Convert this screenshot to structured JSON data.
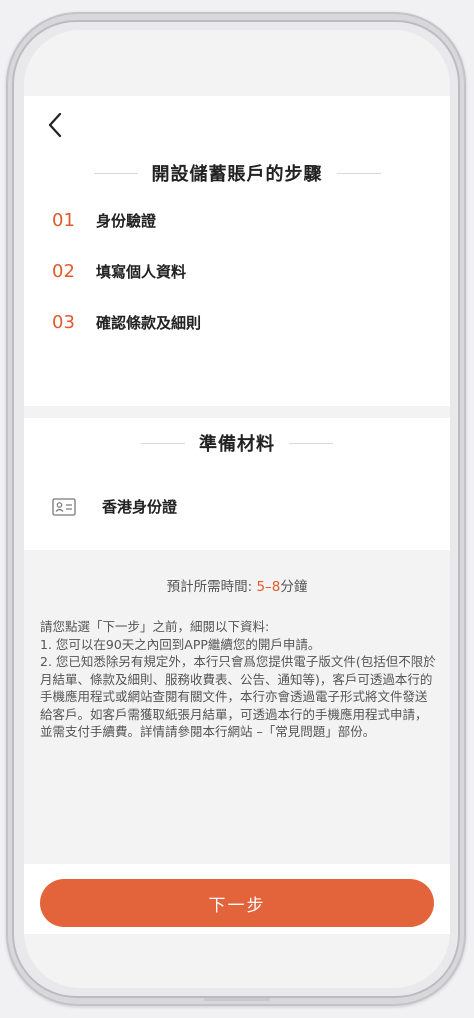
{
  "header": {
    "back_icon": "chevron-left-icon"
  },
  "steps": {
    "title": "開設儲蓄賬戶的步驟",
    "items": [
      {
        "number": "01",
        "label": "身份驗證"
      },
      {
        "number": "02",
        "label": "填寫個人資料"
      },
      {
        "number": "03",
        "label": "確認條款及細則"
      }
    ]
  },
  "materials": {
    "title": "準備材料",
    "items": [
      {
        "icon": "id-card-icon",
        "label": "香港身份證"
      }
    ]
  },
  "time": {
    "label": "預計所需時間:",
    "range": "5–8",
    "unit": "分鐘"
  },
  "notice": {
    "intro": "請您點選「下一步」之前，細閱以下資料:",
    "point1": "1. 您可以在90天之內回到APP繼續您的開戶申請。",
    "point2": "2. 您已知悉除另有規定外，本行只會爲您提供電子版文件(包括但不限於月結單、條款及細則、服務收費表、公告、通知等)，客戶可透過本行的手機應用程式或網站查閱有關文件，本行亦會透過電子形式將文件發送給客戶。如客戶需獲取紙張月結單，可透過本行的手機應用程式申請，並需支付手續費。詳情請參閱本行網站 –「常見問題」部份。"
  },
  "actions": {
    "next_label": "下一步"
  },
  "colors": {
    "accent": "#e3633a",
    "step_number": "#e2592b"
  }
}
